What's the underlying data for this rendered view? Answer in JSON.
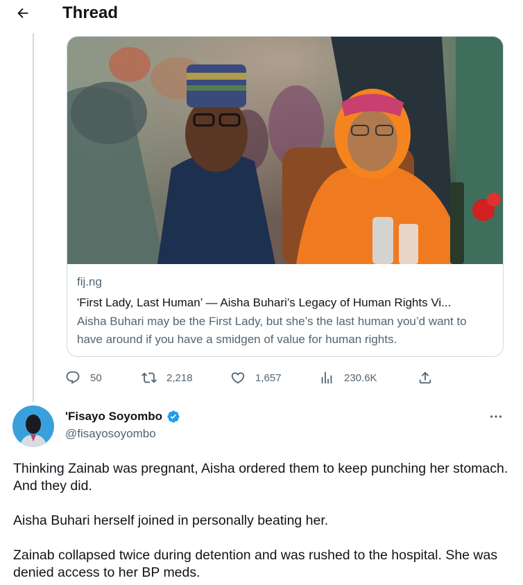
{
  "header": {
    "title": "Thread"
  },
  "card": {
    "domain": "fij.ng",
    "title": "'First Lady, Last Human’ — Aisha Buhari’s Legacy of Human Rights Vi...",
    "description": "Aisha Buhari may be the First Lady, but she’s the last human you’d want to have around if you have a smidgen of value for human rights."
  },
  "actions": {
    "replies": "50",
    "retweets": "2,218",
    "likes": "1,657",
    "views": "230.6K"
  },
  "tweet": {
    "author_name": "'Fisayo Soyombo",
    "author_handle": "@fisayosoyombo",
    "paragraphs": [
      "Thinking Zainab was pregnant, Aisha ordered them to keep punching her stomach. And they did.",
      "Aisha Buhari herself joined in personally beating her.",
      "Zainab collapsed twice during detention and was rushed to the hospital. She was denied access to her BP meds."
    ]
  },
  "colors": {
    "text": "#0f1419",
    "secondary": "#536471",
    "border": "#cfd9de",
    "verified": "#1d9bf0"
  },
  "icons": [
    "back-arrow-icon",
    "reply-icon",
    "retweet-icon",
    "like-icon",
    "views-icon",
    "share-icon",
    "verified-badge-icon",
    "more-icon"
  ]
}
